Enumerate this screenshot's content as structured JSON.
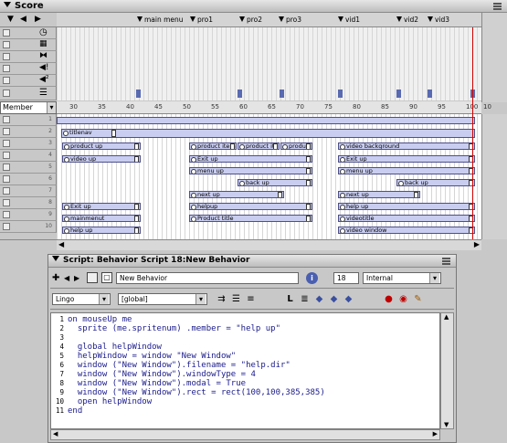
{
  "score": {
    "title": "Score",
    "markers": [
      "main menu",
      "pro1",
      "pro2",
      "pro3",
      "vid1",
      "vid2",
      "vid3"
    ],
    "member_select": "Member",
    "ruler": [
      "30",
      "35",
      "40",
      "45",
      "50",
      "55",
      "60",
      "65",
      "70",
      "75",
      "80",
      "85",
      "90",
      "95",
      "100"
    ],
    "ruler_end": "10",
    "channel_numbers": [
      "1",
      "2",
      "3",
      "4",
      "5",
      "6",
      "7",
      "8",
      "9",
      "10"
    ],
    "sprites": {
      "titlenav": "titlenav",
      "product_up": "product up",
      "video_up": "video up",
      "exit_up_a": "Exit up",
      "mainmenu_up": "mainmenut",
      "help_up_a": "help up",
      "product_item": "product item",
      "product_item2": "product item",
      "product_item3": "produc",
      "exit_up_b": "Exit up",
      "menu_up_b": "menu up",
      "back_up_b": "back up",
      "next_up_b": "next up",
      "help_up_b": "helpup",
      "product_title": "Product title",
      "video_background": "video background",
      "exit_up_c": "Exit up",
      "menu_up_c": "menu up",
      "back_up_c": "back up",
      "next_up_c": "next up",
      "help_up_c": "help up",
      "video_title": "videotitle",
      "video_window": "video window"
    }
  },
  "script": {
    "title": "Script: Behavior Script 18:New Behavior",
    "name_value": "New Behavior",
    "member_number": "18",
    "cast_select": "Internal",
    "language_select": "Lingo",
    "handler_select": "[global]",
    "line_numbers": [
      "1",
      "2",
      "3",
      "4",
      "5",
      "6",
      "7",
      "8",
      "9",
      "10",
      "11"
    ],
    "code_lines": [
      "on mouseUp me",
      "  sprite (me.spritenum) .member = \"help up\"",
      "",
      "  global helpWindow",
      "  helpWindow = window \"New Window\"",
      "  window (\"New Window\").filename = \"help.dir\"",
      "  window (\"New Window\").windowType = 4",
      "  window (\"New Window\").modal = True",
      "  window (\"New Window\").rect = rect(100,100,385,385)",
      "  open helpWindow",
      "end"
    ]
  }
}
